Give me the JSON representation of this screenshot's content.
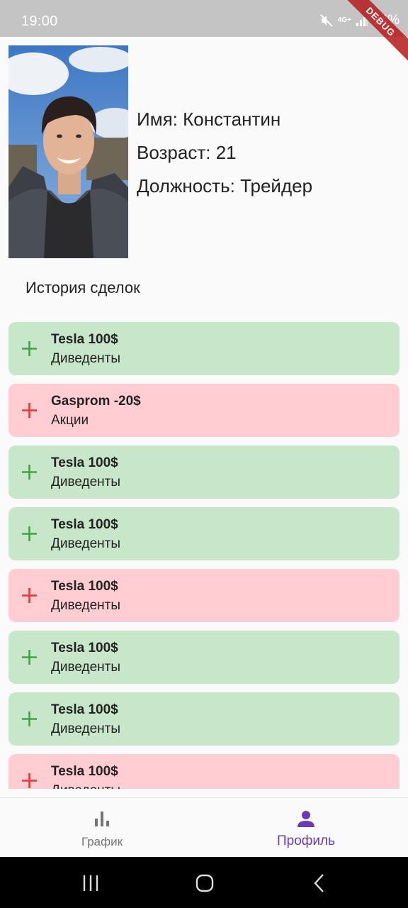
{
  "status_bar": {
    "time": "19:00",
    "network": "4G+",
    "battery": "14%",
    "debug_banner": "DEBUG"
  },
  "profile": {
    "photo_alt": "photo",
    "name_line": "Имя: Константин",
    "age_line": "Возраст: 21",
    "position_line": "Должность: Трейдер"
  },
  "history_title": "История сделок",
  "deals": [
    {
      "title": "Tesla 100$",
      "subtitle": "Диведенты",
      "kind": "plus"
    },
    {
      "title": "Gasprom -20$",
      "subtitle": "Акции",
      "kind": "minus"
    },
    {
      "title": "Tesla 100$",
      "subtitle": "Диведенты",
      "kind": "plus"
    },
    {
      "title": "Tesla 100$",
      "subtitle": "Диведенты",
      "kind": "plus"
    },
    {
      "title": "Tesla 100$",
      "subtitle": "Диведенты",
      "kind": "minus"
    },
    {
      "title": "Tesla 100$",
      "subtitle": "Диведенты",
      "kind": "plus"
    },
    {
      "title": "Tesla 100$",
      "subtitle": "Диведенты",
      "kind": "plus"
    },
    {
      "title": "Tesla 100$",
      "subtitle": "Диведенты",
      "kind": "minus"
    }
  ],
  "colors": {
    "plus_bg": "#c8e6c9",
    "minus_bg": "#ffcdd2",
    "plus_icon": "#43a047",
    "minus_icon": "#e53935",
    "accent": "#6a3bb5"
  },
  "bottom_nav": {
    "items": [
      {
        "label": "График",
        "icon": "bar-chart-icon",
        "active": false
      },
      {
        "label": "Профиль",
        "icon": "person-icon",
        "active": true
      }
    ]
  }
}
